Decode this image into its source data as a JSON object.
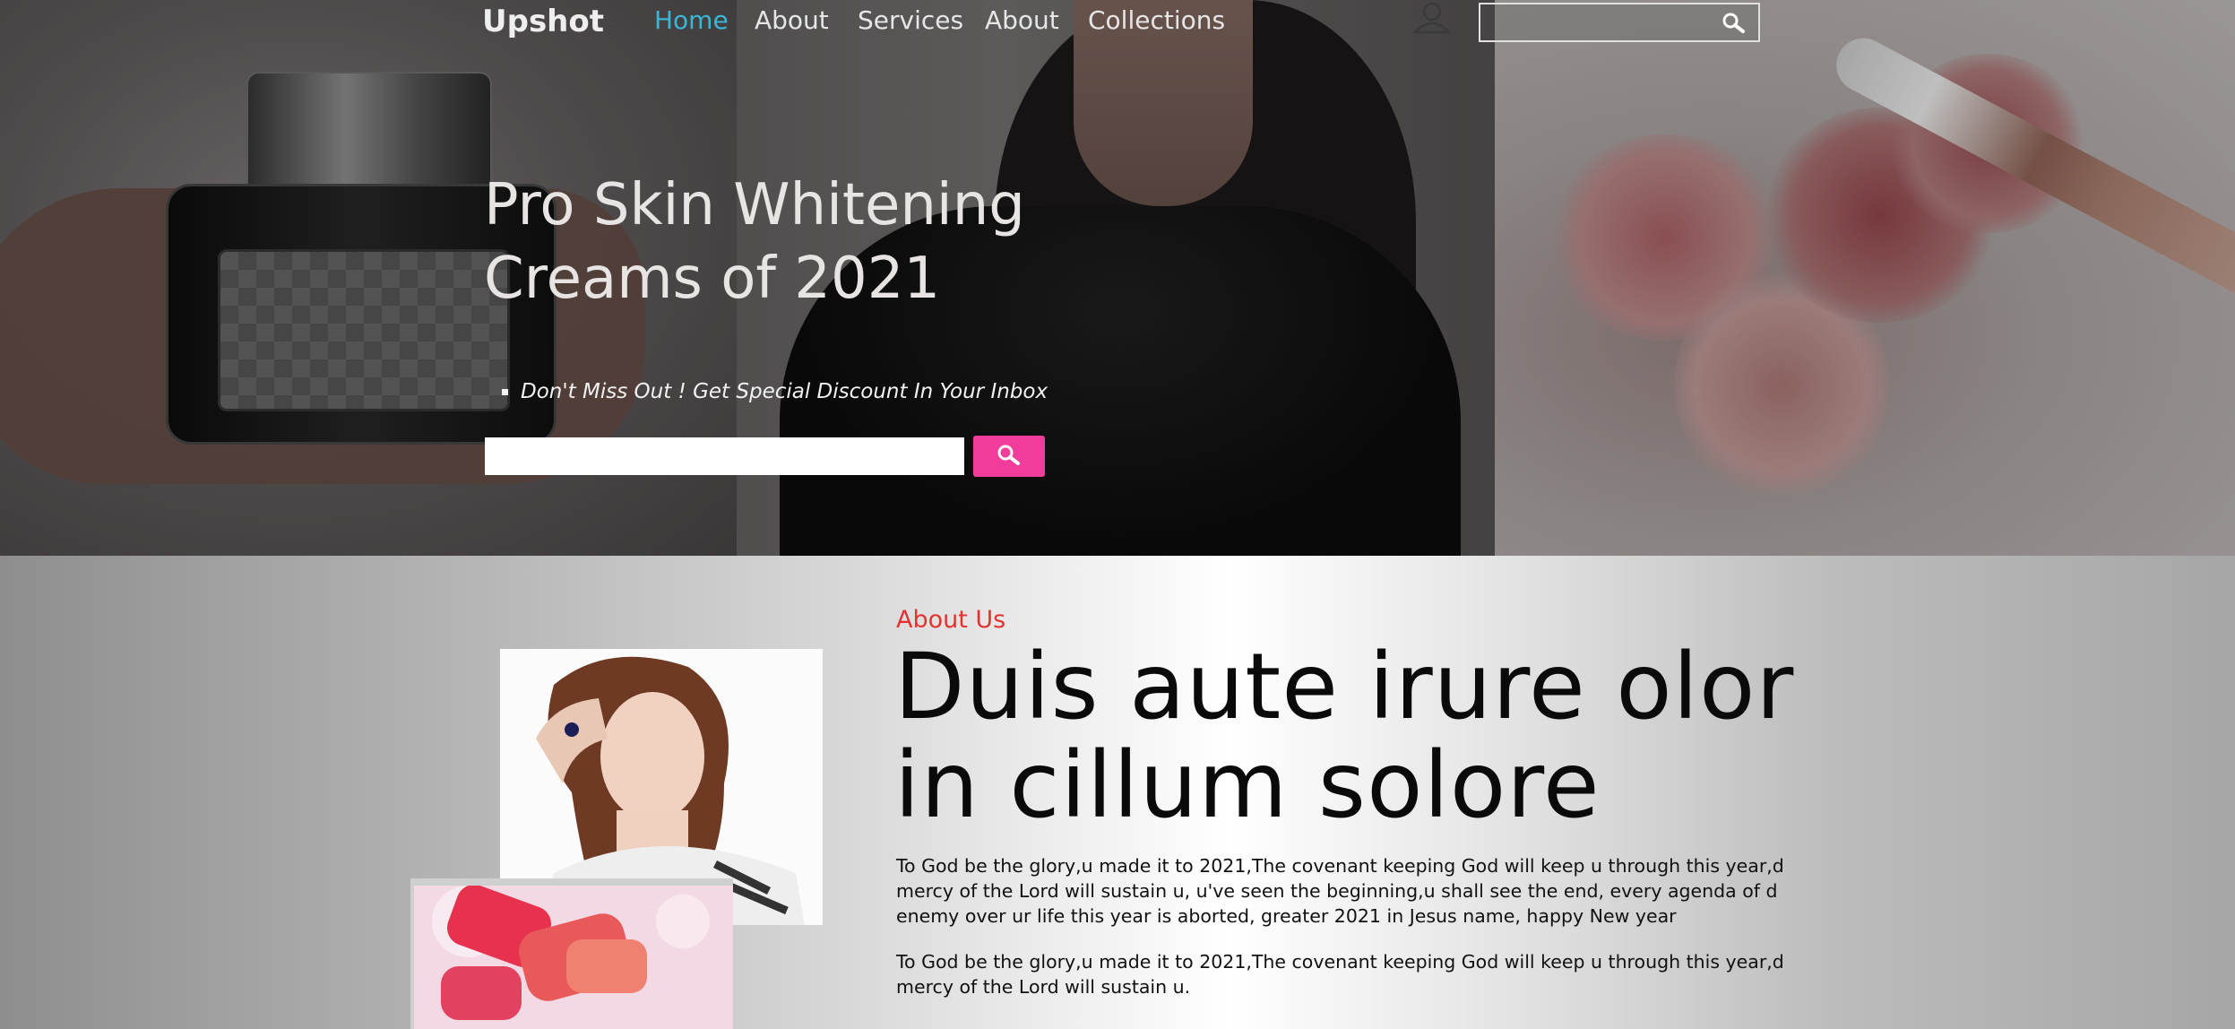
{
  "nav": {
    "logo": "Upshot",
    "links": [
      "Home",
      "About",
      "Services",
      "About",
      "Collections"
    ],
    "active_index": 0,
    "search_placeholder": "",
    "icons": [
      "user-icon",
      "search-icon"
    ]
  },
  "hero": {
    "title": "Pro Skin Whitening Creams of 2021",
    "subtitle": "Don't Miss Out ! Get Special Discount In Your Inbox",
    "email_placeholder": "",
    "submit_icon": "search-icon",
    "colors": {
      "button": "#f03d9b",
      "active_link": "#3ab6d6"
    }
  },
  "about": {
    "label": "About Us",
    "heading": "Duis aute irure olor in cillum solore",
    "paragraphs": [
      "To God be the glory,u made it to 2021,The covenant keeping God will keep u through this year,d mercy of the Lord will sustain u, u've seen the beginning,u shall see the end, every agenda of d enemy over ur life this year is aborted, greater 2021 in Jesus name, happy New year",
      "To God be the glory,u made it to 2021,The covenant keeping God will keep u through this year,d mercy of the Lord will sustain u."
    ],
    "label_color": "#e53131"
  }
}
